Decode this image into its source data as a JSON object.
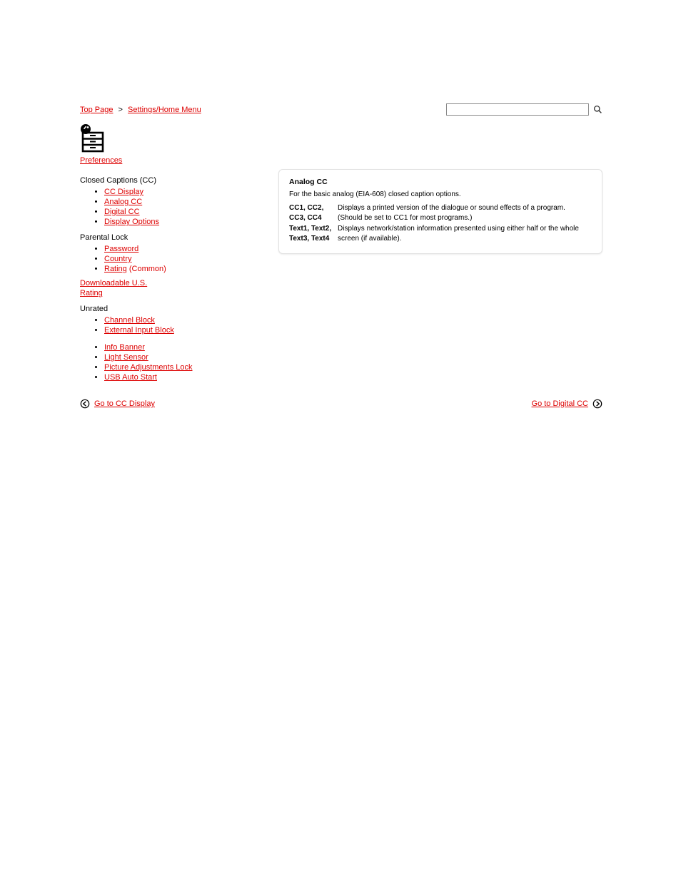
{
  "breadcrumb": {
    "item1": "Top Page",
    "sep": ">",
    "item2": "Settings/Home Menu"
  },
  "search": {
    "placeholder": "",
    "value": ""
  },
  "nav": {
    "section_link": "Preferences",
    "group1_label": "Closed Captions (CC)",
    "group1_items": [
      "CC Display",
      "Analog CC",
      "Digital CC",
      "Display Options"
    ],
    "group2_label": "Parental Lock",
    "group2_items_a": [
      "Password",
      "Country"
    ],
    "group2_item_rating": "Rating",
    "group2_item_rating_sub": "(Common)",
    "group3a": "Downloadable U.S.",
    "group3b": "Rating",
    "group4_label": "Unrated",
    "group4_items": [
      "Channel Block",
      "External Input Block"
    ],
    "group5_items": [
      "Info Banner",
      "Light Sensor",
      "Picture Adjustments Lock",
      "USB Auto Start"
    ]
  },
  "card": {
    "title": "Analog CC",
    "subtitle": "For the basic analog (EIA-608) closed caption options.",
    "row1_term": "CC1, CC2, CC3, CC4",
    "row1_desc": "Displays a printed version of the dialogue or sound effects of a program. (Should be set to CC1 for most programs.)",
    "row2_term": "Text1, Text2, Text3, Text4",
    "row2_desc": "Displays network/station information presented using either half or the whole screen (if available)."
  },
  "pager": {
    "prev": "Go to CC Display",
    "next": "Go to Digital CC"
  }
}
